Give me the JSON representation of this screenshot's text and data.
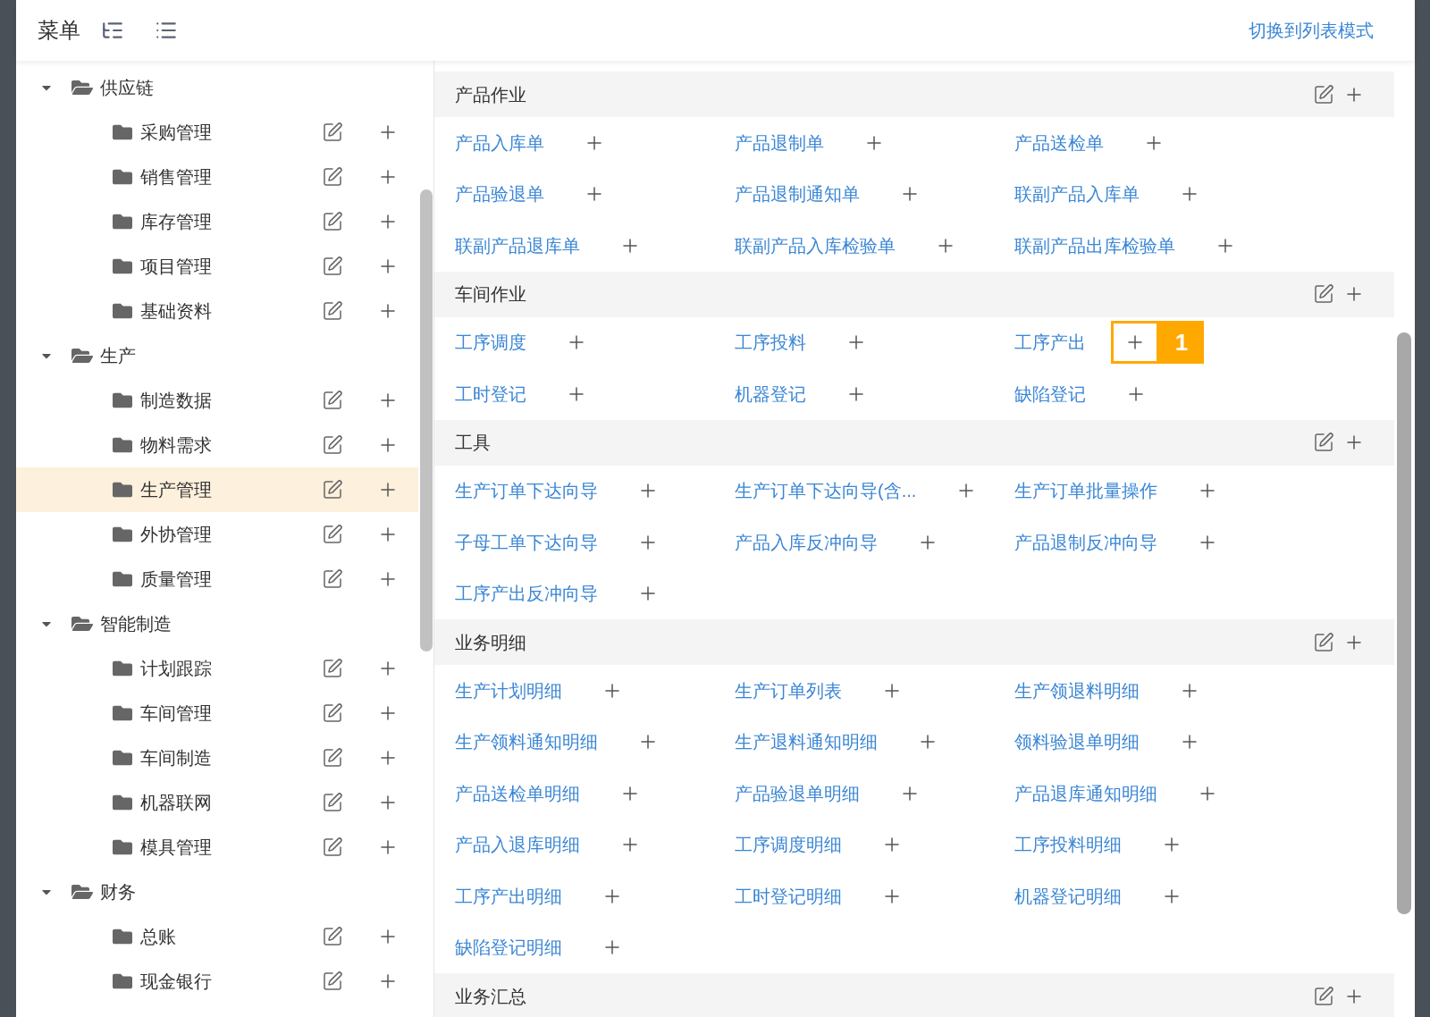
{
  "header": {
    "title": "菜单",
    "switch_link": "切换到列表模式"
  },
  "tree": [
    {
      "label": "供应链",
      "expanded": true,
      "children": [
        {
          "label": "采购管理",
          "selected": false
        },
        {
          "label": "销售管理",
          "selected": false
        },
        {
          "label": "库存管理",
          "selected": false
        },
        {
          "label": "项目管理",
          "selected": false
        },
        {
          "label": "基础资料",
          "selected": false
        }
      ]
    },
    {
      "label": "生产",
      "expanded": true,
      "children": [
        {
          "label": "制造数据",
          "selected": false
        },
        {
          "label": "物料需求",
          "selected": false
        },
        {
          "label": "生产管理",
          "selected": true
        },
        {
          "label": "外协管理",
          "selected": false
        },
        {
          "label": "质量管理",
          "selected": false
        }
      ]
    },
    {
      "label": "智能制造",
      "expanded": true,
      "children": [
        {
          "label": "计划跟踪",
          "selected": false
        },
        {
          "label": "车间管理",
          "selected": false
        },
        {
          "label": "车间制造",
          "selected": false
        },
        {
          "label": "机器联网",
          "selected": false
        },
        {
          "label": "模具管理",
          "selected": false
        }
      ]
    },
    {
      "label": "财务",
      "expanded": true,
      "children": [
        {
          "label": "总账",
          "selected": false
        },
        {
          "label": "现金银行",
          "selected": false
        }
      ]
    }
  ],
  "sections": [
    {
      "title": "产品作业",
      "items": [
        {
          "label": "产品入库单"
        },
        {
          "label": "产品退制单"
        },
        {
          "label": "产品送检单"
        },
        {
          "label": "产品验退单"
        },
        {
          "label": "产品退制通知单"
        },
        {
          "label": "联副产品入库单"
        },
        {
          "label": "联副产品退库单"
        },
        {
          "label": "联副产品入库检验单"
        },
        {
          "label": "联副产品出库检验单"
        }
      ]
    },
    {
      "title": "车间作业",
      "items": [
        {
          "label": "工序调度"
        },
        {
          "label": "工序投料"
        },
        {
          "label": "工序产出",
          "badge": "1"
        },
        {
          "label": "工时登记"
        },
        {
          "label": "机器登记"
        },
        {
          "label": "缺陷登记"
        }
      ]
    },
    {
      "title": "工具",
      "items": [
        {
          "label": "生产订单下达向导"
        },
        {
          "label": "生产订单下达向导(含..."
        },
        {
          "label": "生产订单批量操作"
        },
        {
          "label": "子母工单下达向导"
        },
        {
          "label": "产品入库反冲向导"
        },
        {
          "label": "产品退制反冲向导"
        },
        {
          "label": "工序产出反冲向导"
        }
      ]
    },
    {
      "title": "业务明细",
      "items": [
        {
          "label": "生产计划明细"
        },
        {
          "label": "生产订单列表"
        },
        {
          "label": "生产领退料明细"
        },
        {
          "label": "生产领料通知明细"
        },
        {
          "label": "生产退料通知明细"
        },
        {
          "label": "领料验退单明细"
        },
        {
          "label": "产品送检单明细"
        },
        {
          "label": "产品验退单明细"
        },
        {
          "label": "产品退库通知明细"
        },
        {
          "label": "产品入退库明细"
        },
        {
          "label": "工序调度明细"
        },
        {
          "label": "工序投料明细"
        },
        {
          "label": "工序产出明细"
        },
        {
          "label": "工时登记明细"
        },
        {
          "label": "机器登记明细"
        },
        {
          "label": "缺陷登记明细"
        }
      ]
    },
    {
      "title": "业务汇总"
    }
  ]
}
